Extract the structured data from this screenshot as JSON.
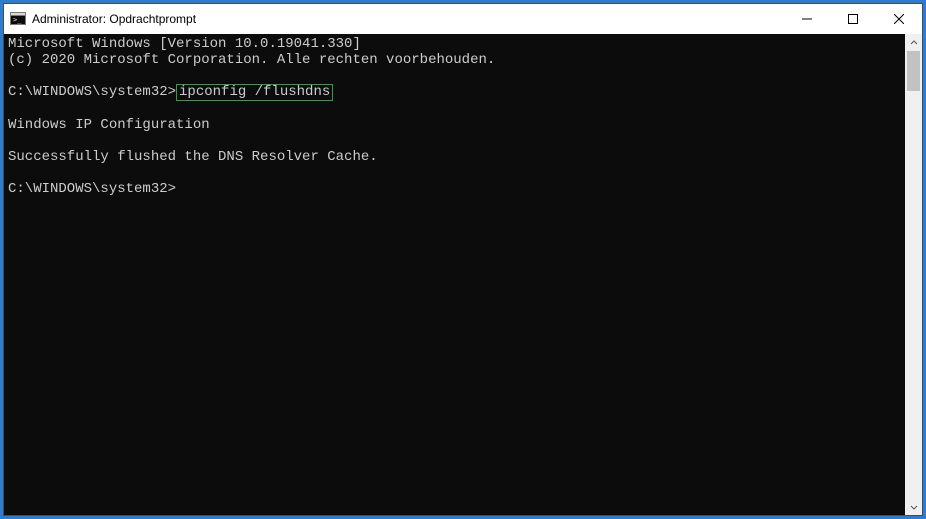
{
  "window": {
    "title": "Administrator: Opdrachtprompt"
  },
  "terminal": {
    "line1": "Microsoft Windows [Version 10.0.19041.330]",
    "line2": "(c) 2020 Microsoft Corporation. Alle rechten voorbehouden.",
    "prompt1_path": "C:\\WINDOWS\\system32>",
    "prompt1_cmd": "ipconfig /flushdns",
    "blank": "",
    "cfg_header": "Windows IP Configuration",
    "result": "Successfully flushed the DNS Resolver Cache.",
    "prompt2_path": "C:\\WINDOWS\\system32>"
  }
}
